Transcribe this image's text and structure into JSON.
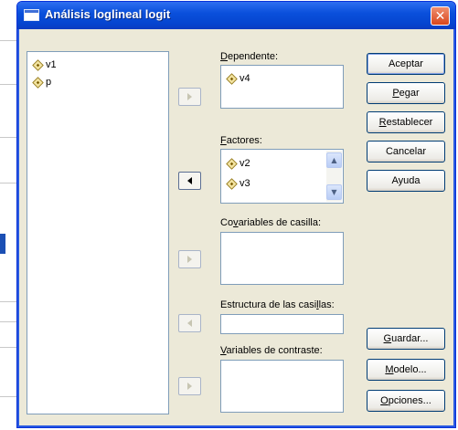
{
  "dialog": {
    "title": "Análisis loglineal logit",
    "close_glyph": "✕"
  },
  "variables_list": {
    "items": [
      "v1",
      "p"
    ]
  },
  "dependent": {
    "label_u": "D",
    "label_rest": "ependente:",
    "items": [
      "v4"
    ]
  },
  "factors": {
    "label_u": "F",
    "label_rest": "actores:",
    "items": [
      "v2",
      "v3"
    ]
  },
  "cell_covariates": {
    "label_pre": "Co",
    "label_u": "v",
    "label_rest": "ariables de casilla:"
  },
  "cell_structure": {
    "label_pre": "Estructura de las casi",
    "label_u": "l",
    "label_rest": "las:"
  },
  "contrast_variables": {
    "label_u": "V",
    "label_rest": "ariables de contraste:"
  },
  "buttons": {
    "accept": "Aceptar",
    "paste_u": "P",
    "paste_rest": "egar",
    "reset_u": "R",
    "reset_rest": "establecer",
    "cancel": "Cancelar",
    "help": "Ayuda",
    "save_u": "G",
    "save_rest": "uardar...",
    "model_u": "M",
    "model_rest": "odelo...",
    "options_u": "O",
    "options_rest": "pciones..."
  },
  "colors": {
    "title_bar": "#0a50dc",
    "dialog_bg": "#ece9d8",
    "close_button": "#d9461c"
  }
}
